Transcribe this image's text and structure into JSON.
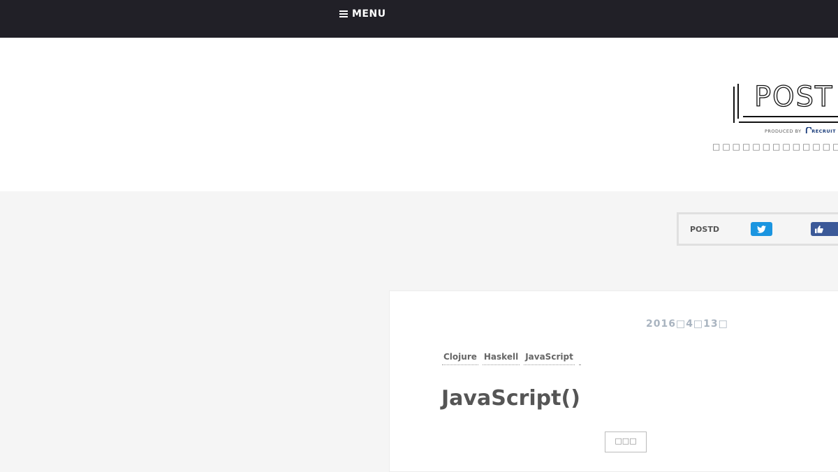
{
  "nav": {
    "menu_label": "MENU"
  },
  "branding": {
    "logo_text": "POST",
    "produced_by": "PRODUCED BY",
    "recruit": "RECRUIT",
    "tagline": "□□□□□□□□□□□□□□□□□□□□□□"
  },
  "share": {
    "label": "POSTD"
  },
  "article": {
    "date": "2016□4□13□",
    "tags": [
      "Clojure",
      "Haskell",
      "JavaScript"
    ],
    "title": "JavaScript()",
    "button_label": "□□□"
  }
}
